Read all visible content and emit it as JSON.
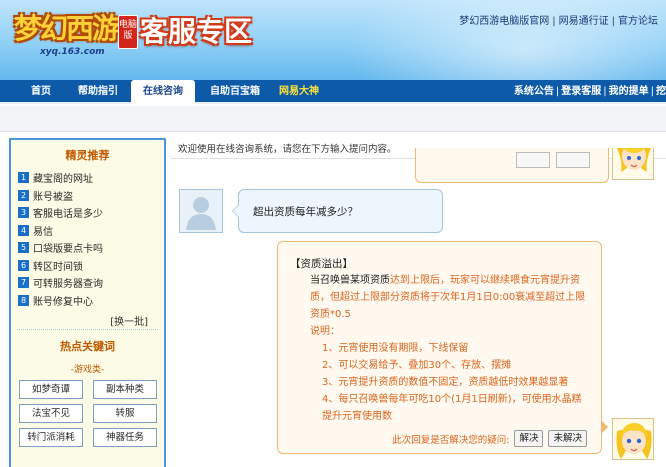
{
  "header": {
    "logo_text": "梦幻西游",
    "logo_badge": "电脑版",
    "logo_sub": "xyq.163.com",
    "title": "客服专区",
    "links": [
      "梦幻西游电脑版官网",
      "网易通行证",
      "官方论坛"
    ]
  },
  "nav": {
    "tabs": [
      {
        "label": "首页"
      },
      {
        "label": "帮助指引"
      },
      {
        "label": "在线咨询"
      },
      {
        "label": "自助百宝箱"
      },
      {
        "label": "网易大神"
      }
    ],
    "active_tab": "在线咨询",
    "right_links": [
      "系统公告",
      "登录客服",
      "我的提单",
      "挖"
    ]
  },
  "sidebar": {
    "title": "精灵推荐",
    "items": [
      {
        "num": "1",
        "label": "藏宝阁的网址"
      },
      {
        "num": "2",
        "label": "账号被盗"
      },
      {
        "num": "3",
        "label": "客服电话是多少"
      },
      {
        "num": "4",
        "label": "易信"
      },
      {
        "num": "5",
        "label": "口袋版要点卡吗"
      },
      {
        "num": "6",
        "label": "转区时间锁"
      },
      {
        "num": "7",
        "label": "可转服务器查询"
      },
      {
        "num": "8",
        "label": "账号修复中心"
      }
    ],
    "refresh_label": "[换一批]",
    "hot_title": "热点关键词",
    "category": "-游戏类-",
    "keywords": [
      "如梦奇谭",
      "副本种类",
      "法宝不见",
      "转服",
      "转门派消耗",
      "神器任务"
    ]
  },
  "main": {
    "welcome": "欢迎使用在线咨询系统，请您在下方输入提问内容。",
    "question": "超出资质每年减多少？",
    "answer": {
      "title": "【资质溢出】",
      "intro_plain": "当召唤兽某项资质",
      "intro_orange": "达到上限后，玩家可以继续喂食元宵提升资质，但超过上限部分资质将于次年1月1日0:00衰减至超过上限资质*0.5",
      "note_title": "说明：",
      "notes": [
        "1、元宵使用没有期限，下线保留",
        "2、可以交易给予、叠加30个、存放、摆摊",
        "3、元宵提升资质的数值不固定，资质越低时效果越显著",
        "4、每只召唤兽每年可吃10个(1月1日刷新)，可使用水晶糕提升元宵使用数"
      ],
      "feedback_prompt": "此次回复是否解决您的疑问:",
      "resolved_label": "解决",
      "unresolved_label": "未解决"
    }
  },
  "colors": {
    "nav_bg": "#0c5aa8",
    "accent_orange": "#d9651f",
    "sidebar_bg": "#fbfbe6",
    "sidebar_border": "#4a97d9"
  }
}
